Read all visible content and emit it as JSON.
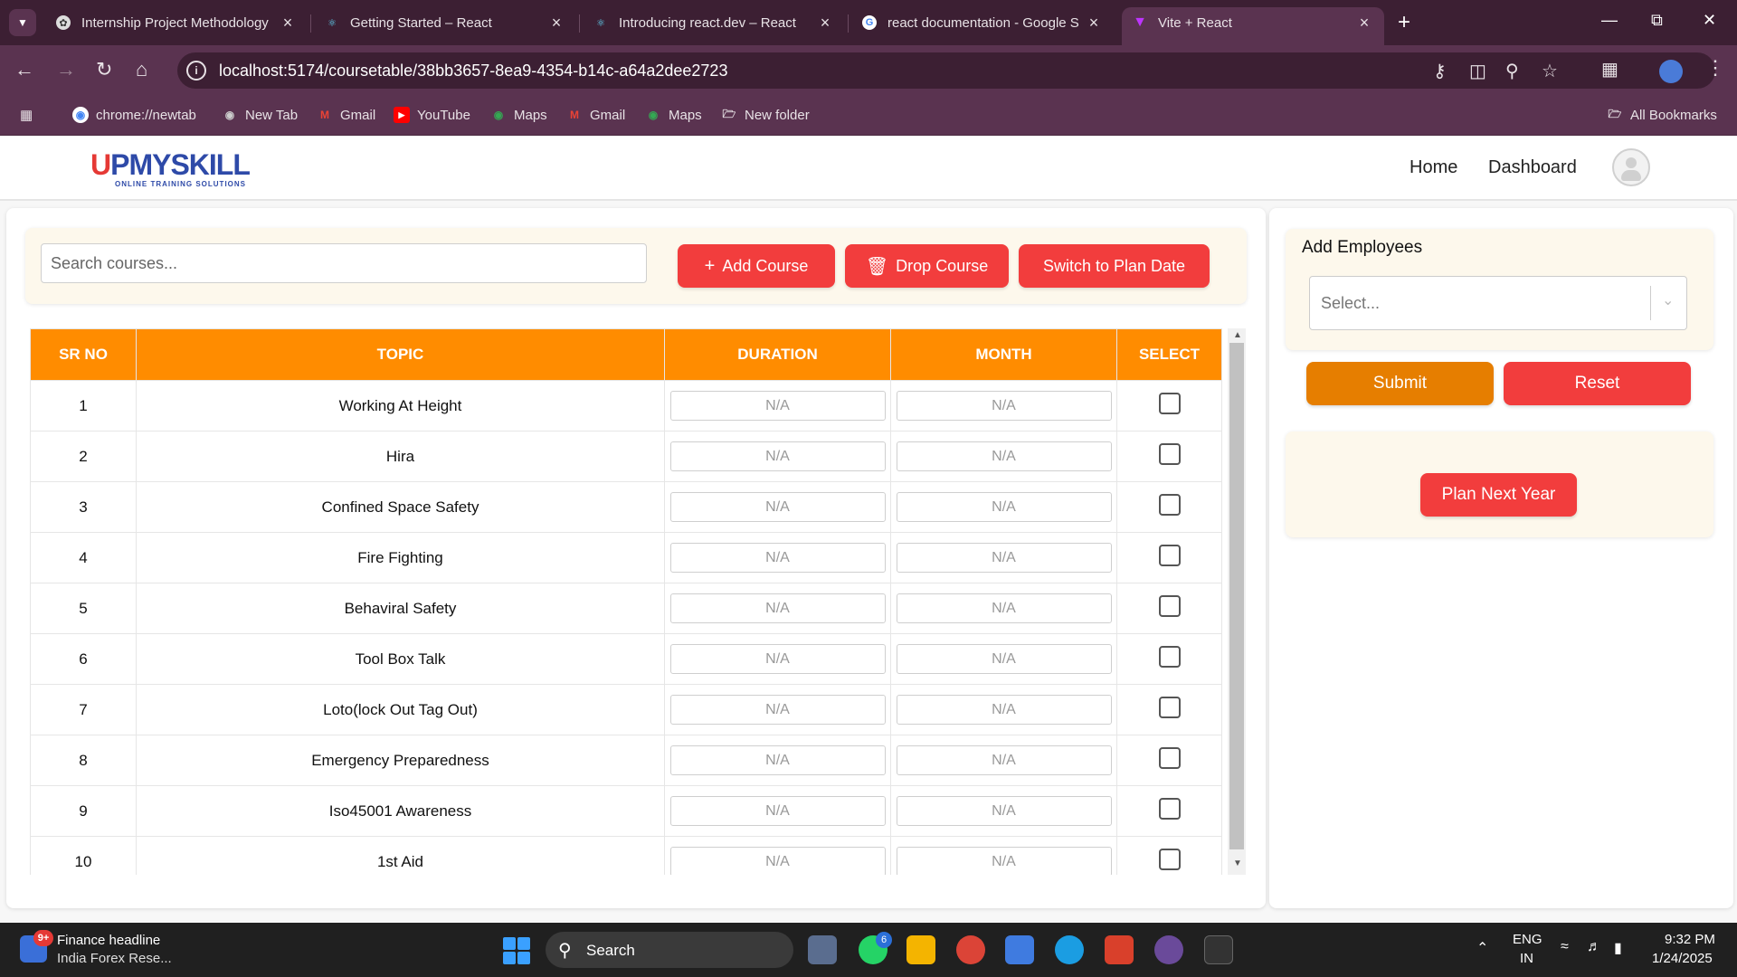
{
  "browser": {
    "tabs": [
      {
        "title": "Internship Project Methodology",
        "icon": "openai-icon"
      },
      {
        "title": "Getting Started – React",
        "icon": "react-icon"
      },
      {
        "title": "Introducing react.dev – React",
        "icon": "react-icon"
      },
      {
        "title": "react documentation - Google S",
        "icon": "google-icon"
      },
      {
        "title": "Vite + React",
        "icon": "vite-icon"
      }
    ],
    "url": "localhost:5174/coursetable/38bb3657-8ea9-4354-b14c-a64a2dee2723",
    "bookmarks": [
      {
        "label": "chrome://newtab",
        "icon": "chrome-icon"
      },
      {
        "label": "New Tab",
        "icon": "globe-icon"
      },
      {
        "label": "Gmail",
        "icon": "gmail-icon"
      },
      {
        "label": "YouTube",
        "icon": "youtube-icon"
      },
      {
        "label": "Maps",
        "icon": "maps-icon"
      },
      {
        "label": "Gmail",
        "icon": "gmail-icon"
      },
      {
        "label": "Maps",
        "icon": "maps-icon"
      },
      {
        "label": "New folder",
        "icon": "folder-icon"
      }
    ],
    "all_bookmarks": "All Bookmarks"
  },
  "app": {
    "logo_text": "UPMYSKILL",
    "logo_tagline": "ONLINE TRAINING SOLUTIONS",
    "nav": {
      "home": "Home",
      "dashboard": "Dashboard"
    },
    "search_placeholder": "Search courses...",
    "buttons": {
      "add_course": "Add Course",
      "drop_course": "Drop Course",
      "switch_plan": "Switch to Plan Date"
    },
    "table": {
      "headers": [
        "SR NO",
        "TOPIC",
        "DURATION",
        "MONTH",
        "SELECT"
      ],
      "placeholder_value": "N/A",
      "rows": [
        {
          "sr": "1",
          "topic": "Working At Height"
        },
        {
          "sr": "2",
          "topic": "Hira"
        },
        {
          "sr": "3",
          "topic": "Confined Space Safety"
        },
        {
          "sr": "4",
          "topic": "Fire Fighting"
        },
        {
          "sr": "5",
          "topic": "Behaviral Safety"
        },
        {
          "sr": "6",
          "topic": "Tool Box Talk"
        },
        {
          "sr": "7",
          "topic": "Loto(lock Out Tag Out)"
        },
        {
          "sr": "8",
          "topic": "Emergency Preparedness"
        },
        {
          "sr": "9",
          "topic": "Iso45001 Awareness"
        },
        {
          "sr": "10",
          "topic": "1st Aid"
        }
      ]
    },
    "employees": {
      "title": "Add Employees",
      "select_placeholder": "Select...",
      "submit": "Submit",
      "reset": "Reset",
      "plan_next_year": "Plan Next Year"
    },
    "colors": {
      "header_orange": "#ff8c00",
      "button_red": "#f23d3d",
      "submit_orange": "#e67e00",
      "card_cream": "#fdf8ec"
    }
  },
  "taskbar": {
    "news_badge": "9+",
    "news_title": "Finance headline",
    "news_subtitle": "India Forex Rese...",
    "search_label": "Search",
    "whatsapp_badge": "6",
    "lang": "ENG",
    "region": "IN",
    "time": "9:32 PM",
    "date": "1/24/2025"
  }
}
